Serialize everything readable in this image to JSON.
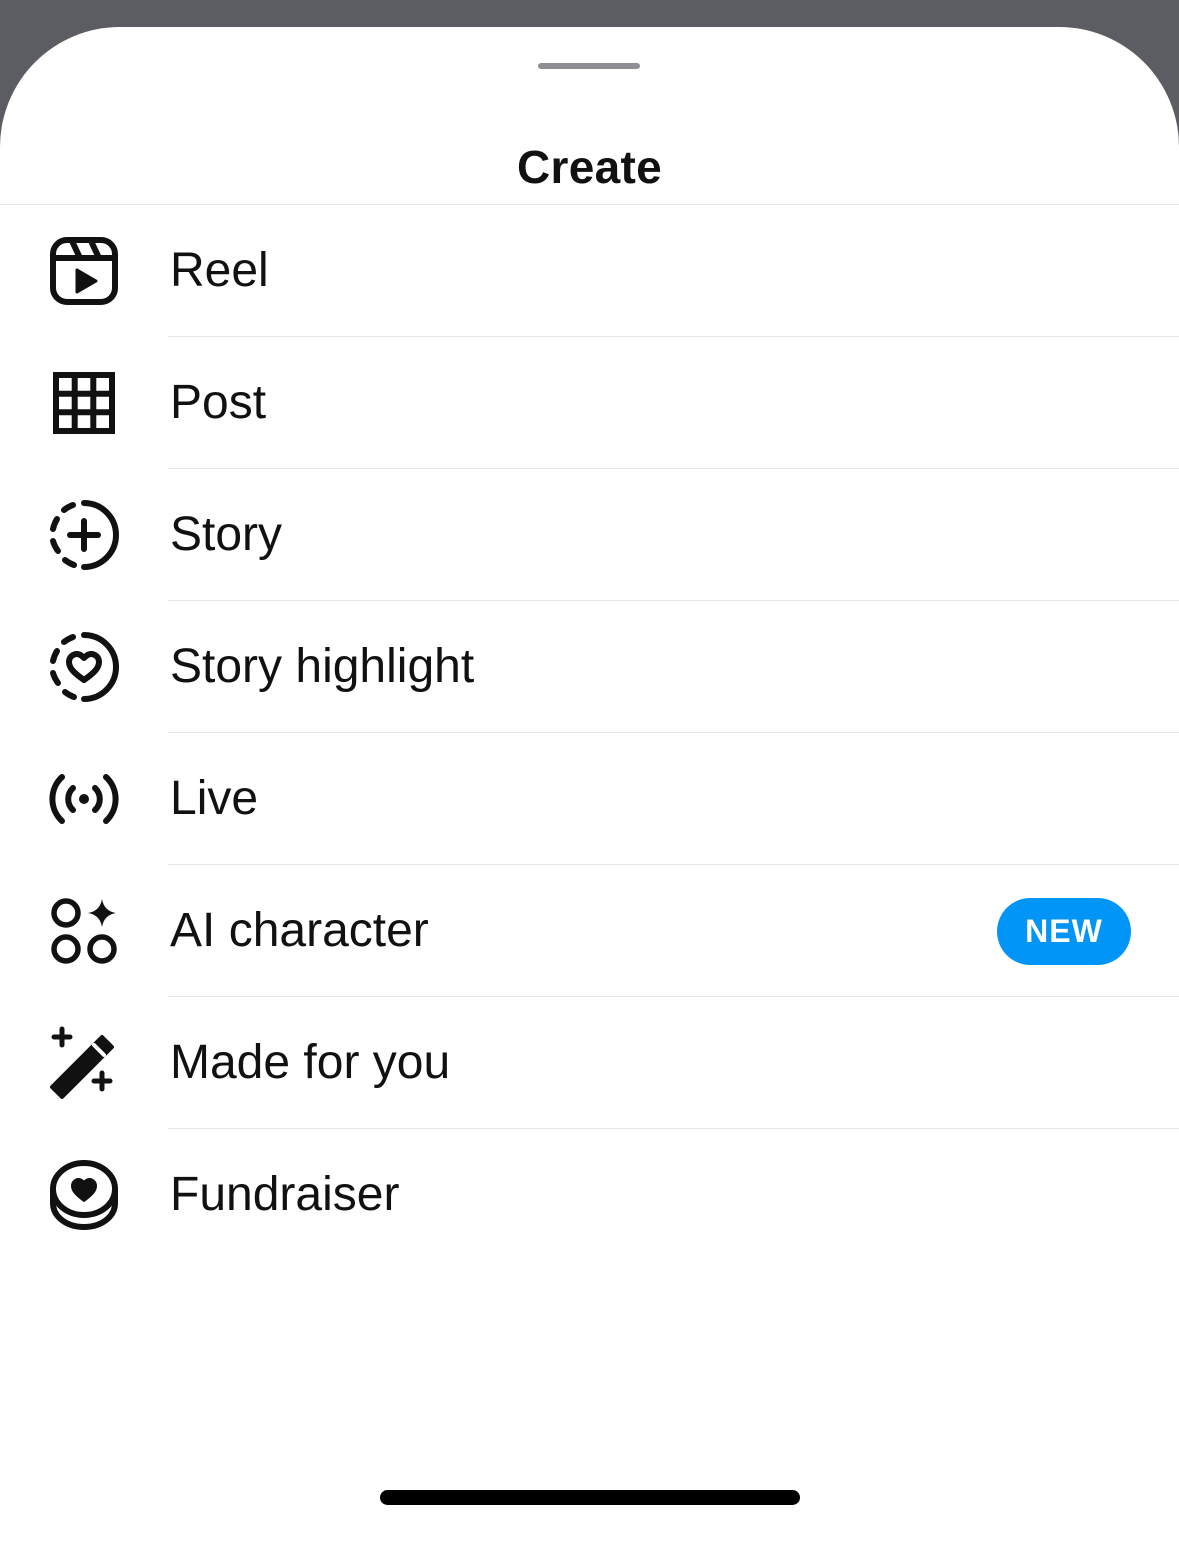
{
  "sheet": {
    "title": "Create"
  },
  "menu": {
    "items": [
      {
        "label": "Reel",
        "icon": "reel-icon"
      },
      {
        "label": "Post",
        "icon": "grid-icon"
      },
      {
        "label": "Story",
        "icon": "story-add-icon"
      },
      {
        "label": "Story highlight",
        "icon": "highlight-heart-icon"
      },
      {
        "label": "Live",
        "icon": "live-broadcast-icon"
      },
      {
        "label": "AI character",
        "icon": "ai-sparkle-icon",
        "badge": "NEW"
      },
      {
        "label": "Made for you",
        "icon": "magic-wand-icon"
      },
      {
        "label": "Fundraiser",
        "icon": "fundraiser-coin-icon"
      }
    ]
  },
  "colors": {
    "text": "#111111",
    "badge_bg": "#0095f6",
    "badge_text": "#ffffff",
    "divider": "#e6e6e6",
    "backdrop": "#5b5d62"
  }
}
